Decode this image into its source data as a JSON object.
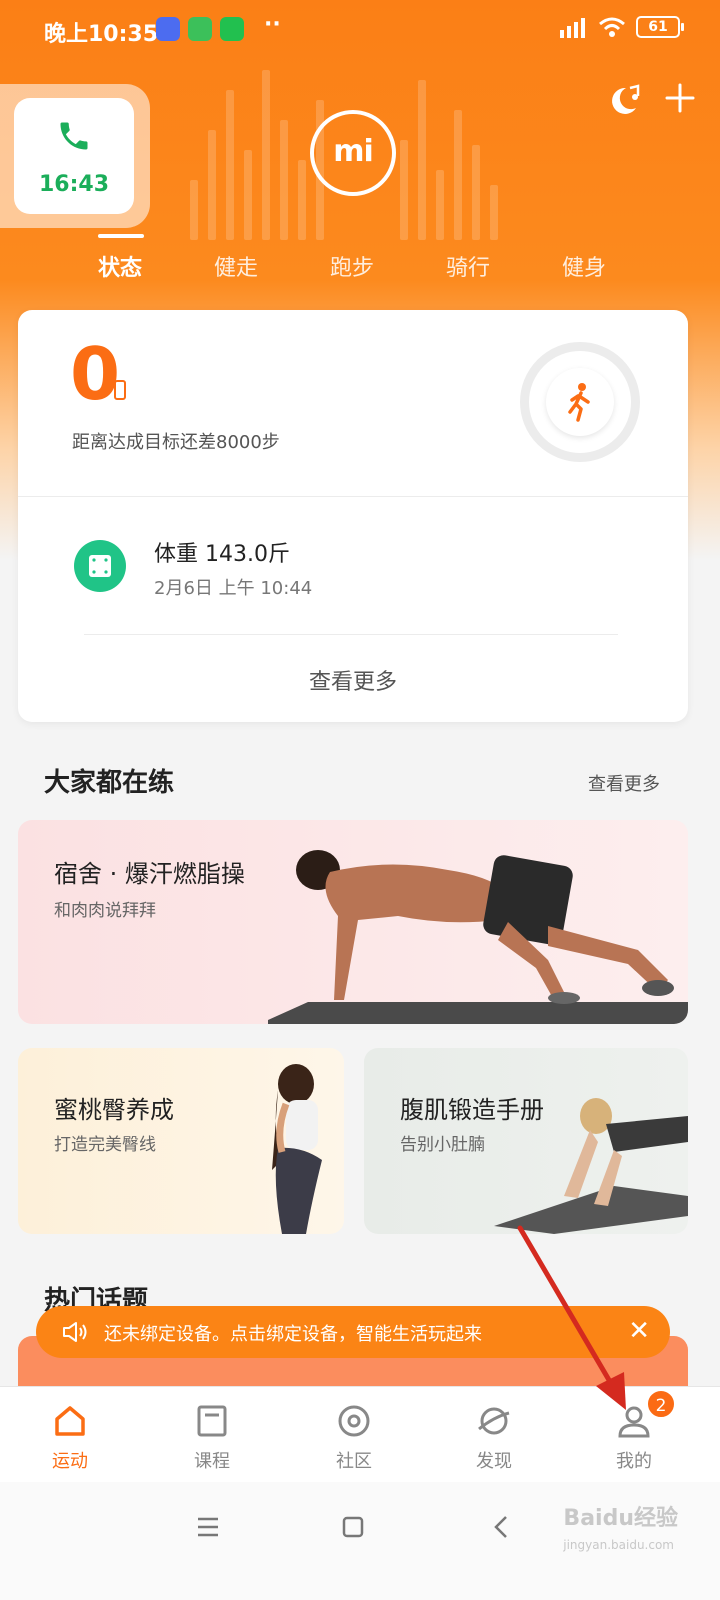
{
  "status_bar": {
    "time": "晚上10:35",
    "battery": "61",
    "more": "··"
  },
  "call_widget": {
    "time": "16:43"
  },
  "logo": {
    "text": "mi"
  },
  "tabs": [
    "状态",
    "健走",
    "跑步",
    "骑行",
    "健身"
  ],
  "steps_card": {
    "steps": "0",
    "subtitle": "距离达成目标还差8000步",
    "weight_title": "体重 143.0斤",
    "weight_date": "2月6日 上午 10:44",
    "see_more": "查看更多"
  },
  "popular": {
    "title": "大家都在练",
    "more": "查看更多",
    "items": [
      {
        "title": "宿舍 · 爆汗燃脂操",
        "subtitle": "和肉肉说拜拜"
      },
      {
        "title": "蜜桃臀养成",
        "subtitle": "打造完美臀线"
      },
      {
        "title": "腹肌锻造手册",
        "subtitle": "告别小肚腩"
      }
    ]
  },
  "topics": {
    "title": "热门话题"
  },
  "toast": {
    "text": "还未绑定设备。点击绑定设备，智能生活玩起来",
    "close": "✕"
  },
  "tabbar": {
    "items": [
      "运动",
      "课程",
      "社区",
      "发现",
      "我的"
    ],
    "badge": "2"
  },
  "watermark": {
    "text": "Baidu经验",
    "sub": "jingyan.baidu.com"
  },
  "colors": {
    "accent": "#fb6d14",
    "green": "#20c487",
    "call_green": "#1bae5a"
  }
}
